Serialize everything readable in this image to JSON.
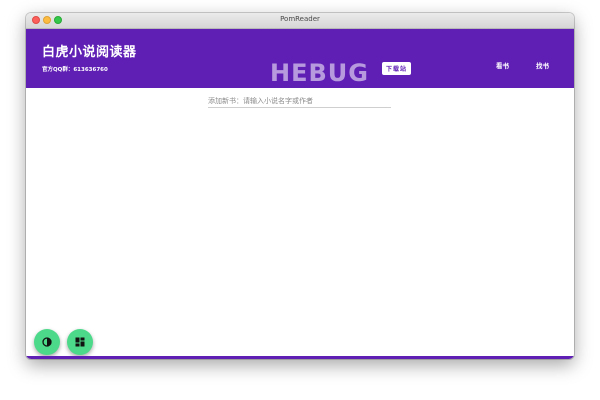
{
  "window": {
    "title": "PomReader"
  },
  "header": {
    "app_title": "白虎小说阅读器",
    "qq_group": "官方QQ群：613636760",
    "nav": {
      "read_label": "看书",
      "find_label": "找书"
    },
    "watermark": {
      "text": "HEBUG",
      "tag": "下载站"
    }
  },
  "search": {
    "placeholder": "添加新书：请输入小说名字或作者",
    "value": ""
  },
  "colors": {
    "accent": "#5f1fb5",
    "fab": "#4cd98a"
  },
  "fabs": [
    {
      "icon": "contrast-icon"
    },
    {
      "icon": "dashboard-icon"
    }
  ]
}
